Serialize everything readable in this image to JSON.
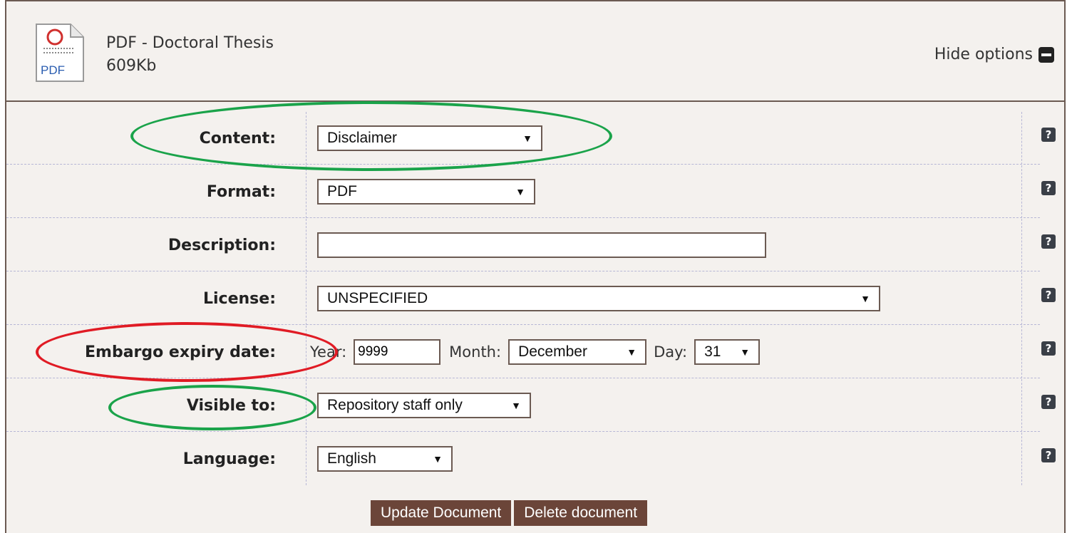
{
  "document": {
    "icon_label": "PDF",
    "title": "PDF - Doctoral Thesis",
    "size": "609Kb"
  },
  "hide_options": "Hide options",
  "help_glyph": "?",
  "fields": {
    "content": {
      "label": "Content:",
      "value": "Disclaimer"
    },
    "format": {
      "label": "Format:",
      "value": "PDF"
    },
    "description": {
      "label": "Description:",
      "value": ""
    },
    "license": {
      "label": "License:",
      "value": "UNSPECIFIED"
    },
    "embargo": {
      "label": "Embargo expiry date:",
      "year_label": "Year:",
      "year_value": "9999",
      "month_label": "Month:",
      "month_value": "December",
      "day_label": "Day:",
      "day_value": "31"
    },
    "visible": {
      "label": "Visible to:",
      "value": "Repository staff only"
    },
    "language": {
      "label": "Language:",
      "value": "English"
    }
  },
  "buttons": {
    "update": "Update Document",
    "delete": "Delete document"
  },
  "annotation_colors": {
    "green": "#1aa34a",
    "red": "#e01b24"
  }
}
